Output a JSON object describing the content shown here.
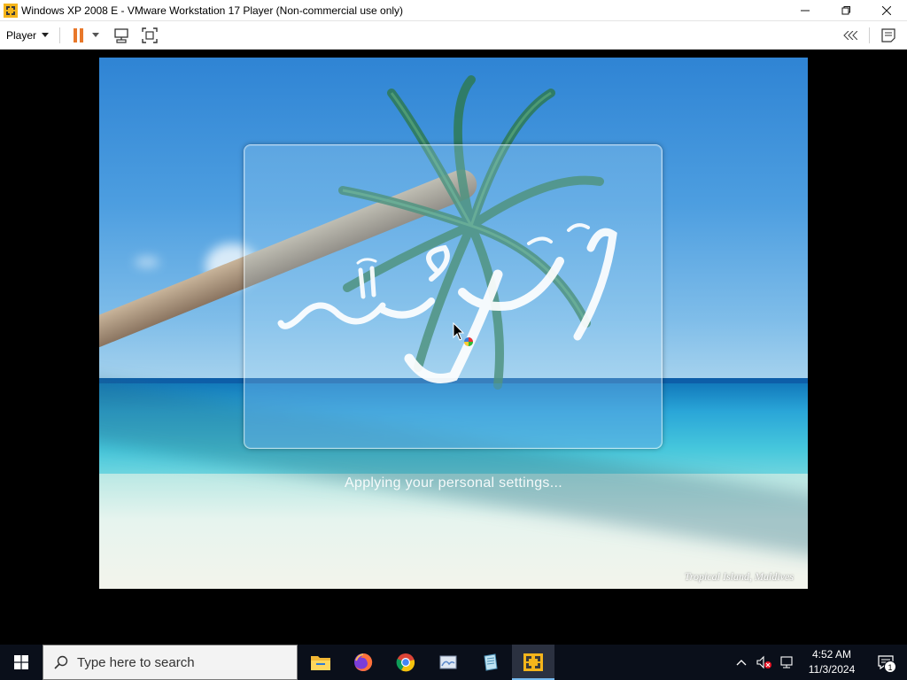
{
  "window": {
    "title": "Windows XP 2008 E - VMware Workstation 17 Player (Non-commercial use only)",
    "controls": {
      "minimize": "minimize-icon",
      "maximize": "restore-icon",
      "close": "close-icon"
    }
  },
  "toolbar": {
    "player_label": "Player",
    "buttons": [
      "pause-icon",
      "dropdown-arrow-icon",
      "send-ctrl-alt-del-icon",
      "fullscreen-icon"
    ],
    "right_buttons": [
      "unity-collapse-icon",
      "message-log-icon"
    ]
  },
  "vm": {
    "status_text": "Applying your personal settings...",
    "caption": "Tropical Island, Maldives",
    "colors": {
      "sky": "#2f84d4",
      "sea": "#2aa6d8",
      "sand": "#f3f4ec"
    }
  },
  "taskbar": {
    "search_placeholder": "Type here to search",
    "apps": [
      "file-explorer-icon",
      "firefox-icon",
      "chrome-icon",
      "paint-icon",
      "notepad-icon",
      "vmware-player-icon"
    ],
    "time": "4:52 AM",
    "date": "11/3/2024",
    "notification_count": "1"
  }
}
